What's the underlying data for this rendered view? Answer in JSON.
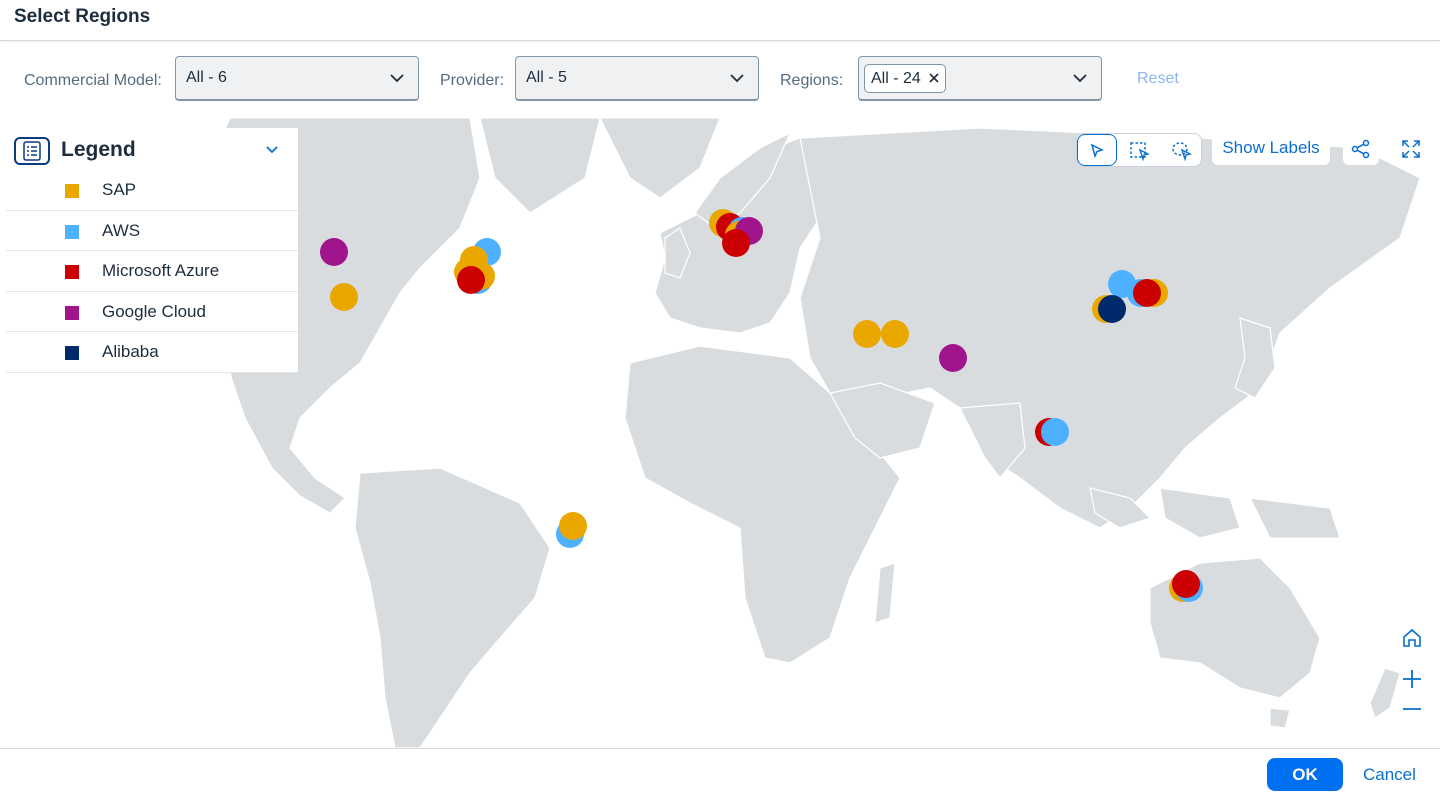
{
  "header": {
    "title": "Select Regions"
  },
  "filters": {
    "commercial_model": {
      "label": "Commercial Model:",
      "value": "All - 6"
    },
    "provider": {
      "label": "Provider:",
      "value": "All - 5"
    },
    "regions": {
      "label": "Regions:",
      "token": "All - 24"
    },
    "reset_label": "Reset"
  },
  "legend": {
    "title": "Legend",
    "items": [
      {
        "label": "SAP",
        "color": "#e9a700"
      },
      {
        "label": "AWS",
        "color": "#4db1ff"
      },
      {
        "label": "Microsoft Azure",
        "color": "#cc0000"
      },
      {
        "label": "Google Cloud",
        "color": "#a0148c"
      },
      {
        "label": "Alibaba",
        "color": "#002a6b"
      }
    ]
  },
  "toolbar": {
    "modes": [
      "pointer-icon",
      "rectangle-select-icon",
      "lasso-select-icon"
    ],
    "show_labels": "Show Labels",
    "share_icon": "share-icon",
    "fullscreen_icon": "fullscreen-icon"
  },
  "zoom": {
    "home_icon": "home-icon",
    "zoom_in_icon": "plus-icon",
    "zoom_out_icon": "minus-icon"
  },
  "footer": {
    "ok_label": "OK",
    "cancel_label": "Cancel"
  },
  "map_markers": [
    {
      "provider": "Google Cloud",
      "lon": -121,
      "lat": 45
    },
    {
      "provider": "SAP",
      "lon": -118,
      "lat": 34
    },
    {
      "provider": "AWS",
      "lon": -73,
      "lat": 45
    },
    {
      "provider": "SAP",
      "lon": -77,
      "lat": 43
    },
    {
      "provider": "SAP",
      "lon": -79,
      "lat": 40
    },
    {
      "provider": "AWS",
      "lon": -76,
      "lat": 38
    },
    {
      "provider": "SAP",
      "lon": -75,
      "lat": 39
    },
    {
      "provider": "Microsoft Azure",
      "lon": -78,
      "lat": 38
    },
    {
      "provider": "SAP",
      "lon": 1,
      "lat": 52
    },
    {
      "provider": "Microsoft Azure",
      "lon": 3,
      "lat": 51
    },
    {
      "provider": "AWS",
      "lon": 7,
      "lat": 50
    },
    {
      "provider": "SAP",
      "lon": 6,
      "lat": 49
    },
    {
      "provider": "Google Cloud",
      "lon": 9,
      "lat": 50
    },
    {
      "provider": "Microsoft Azure",
      "lon": 5,
      "lat": 47
    },
    {
      "provider": "SAP",
      "lon": 46,
      "lat": 25
    },
    {
      "provider": "SAP",
      "lon": 55,
      "lat": 25
    },
    {
      "provider": "Google Cloud",
      "lon": 73,
      "lat": 19
    },
    {
      "provider": "AWS",
      "lon": 126,
      "lat": 37
    },
    {
      "provider": "AWS",
      "lon": 132,
      "lat": 35
    },
    {
      "provider": "SAP",
      "lon": 136,
      "lat": 35
    },
    {
      "provider": "Microsoft Azure",
      "lon": 134,
      "lat": 35
    },
    {
      "provider": "SAP",
      "lon": 121,
      "lat": 31
    },
    {
      "provider": "Alibaba",
      "lon": 123,
      "lat": 31
    },
    {
      "provider": "Microsoft Azure",
      "lon": 103,
      "lat": 1
    },
    {
      "provider": "AWS",
      "lon": 105,
      "lat": 1
    },
    {
      "provider": "AWS",
      "lon": -47,
      "lat": -24
    },
    {
      "provider": "SAP",
      "lon": -46,
      "lat": -22
    },
    {
      "provider": "SAP",
      "lon": 145,
      "lat": -37
    },
    {
      "provider": "AWS",
      "lon": 147,
      "lat": -37
    },
    {
      "provider": "Microsoft Azure",
      "lon": 146,
      "lat": -36
    }
  ]
}
